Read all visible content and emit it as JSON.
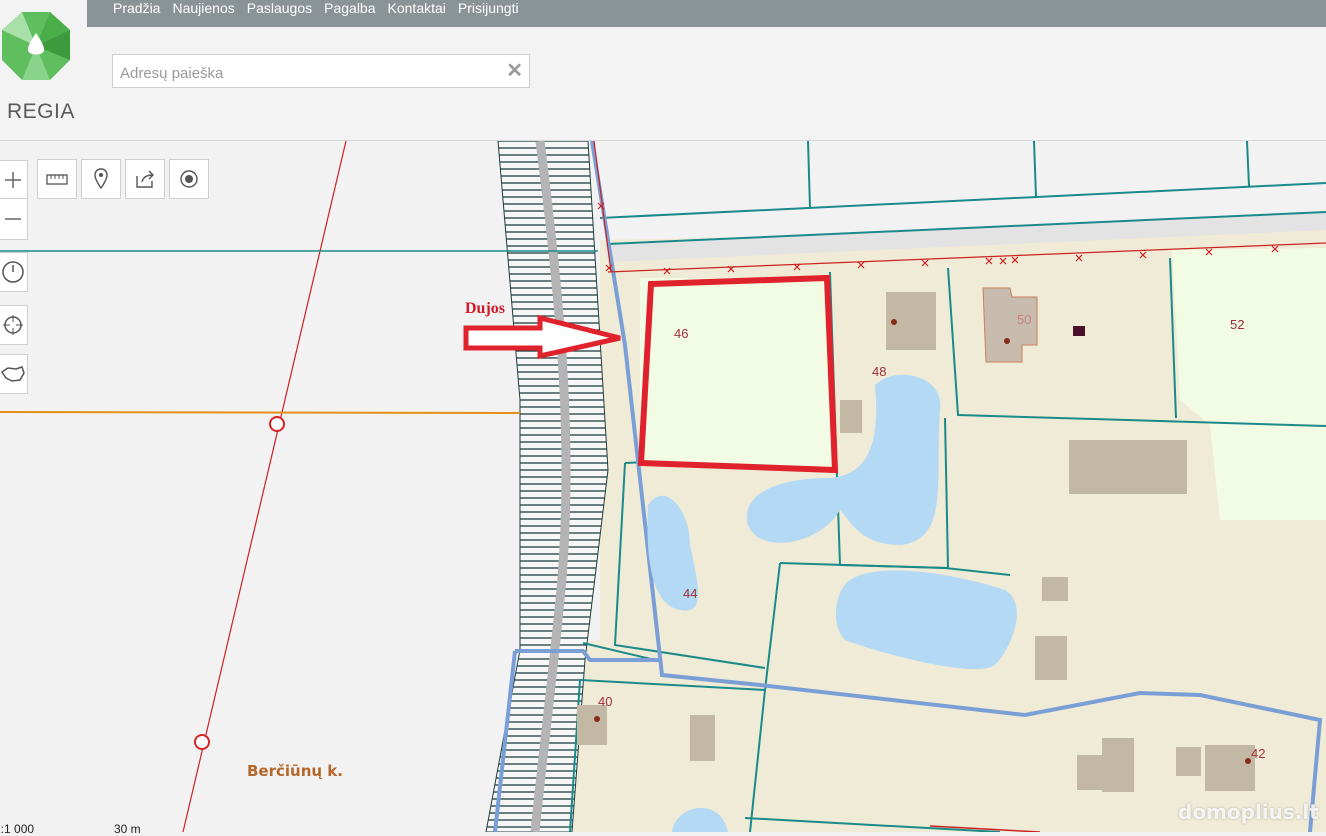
{
  "nav": {
    "items": [
      "Pradžia",
      "Naujienos",
      "Paslaugos",
      "Pagalba",
      "Kontaktai",
      "Prisijungti"
    ]
  },
  "logo": {
    "text": "REGIA"
  },
  "search": {
    "placeholder": "Adresų paieška",
    "value": "",
    "clear_icon": "close-icon"
  },
  "map": {
    "annotation": "Dujos",
    "village_label": "Berčiūnų k.",
    "parcel_labels": [
      "46",
      "48",
      "50",
      "52",
      "44",
      "40",
      "42"
    ],
    "scale": "1:1 000",
    "scale_distance": "30 m",
    "watermark": "domoplius.lt",
    "colors": {
      "plot_fill": "#f0ebd6",
      "water": "#b3d9f5",
      "parcel_boundary": "#1a8a8a",
      "highlight": "#e0222c",
      "building": "#c2b8a3",
      "field_green": "#f2fbe4",
      "blue_line": "#7a9fd6",
      "gas_line": "#e58e1a"
    }
  },
  "tools": [
    "measure-icon",
    "marker-icon",
    "share-icon",
    "location-icon"
  ],
  "zoom": [
    "zoom-in-icon",
    "zoom-out-icon",
    "history-icon",
    "crosshair-icon",
    "lithuania-map-icon"
  ]
}
